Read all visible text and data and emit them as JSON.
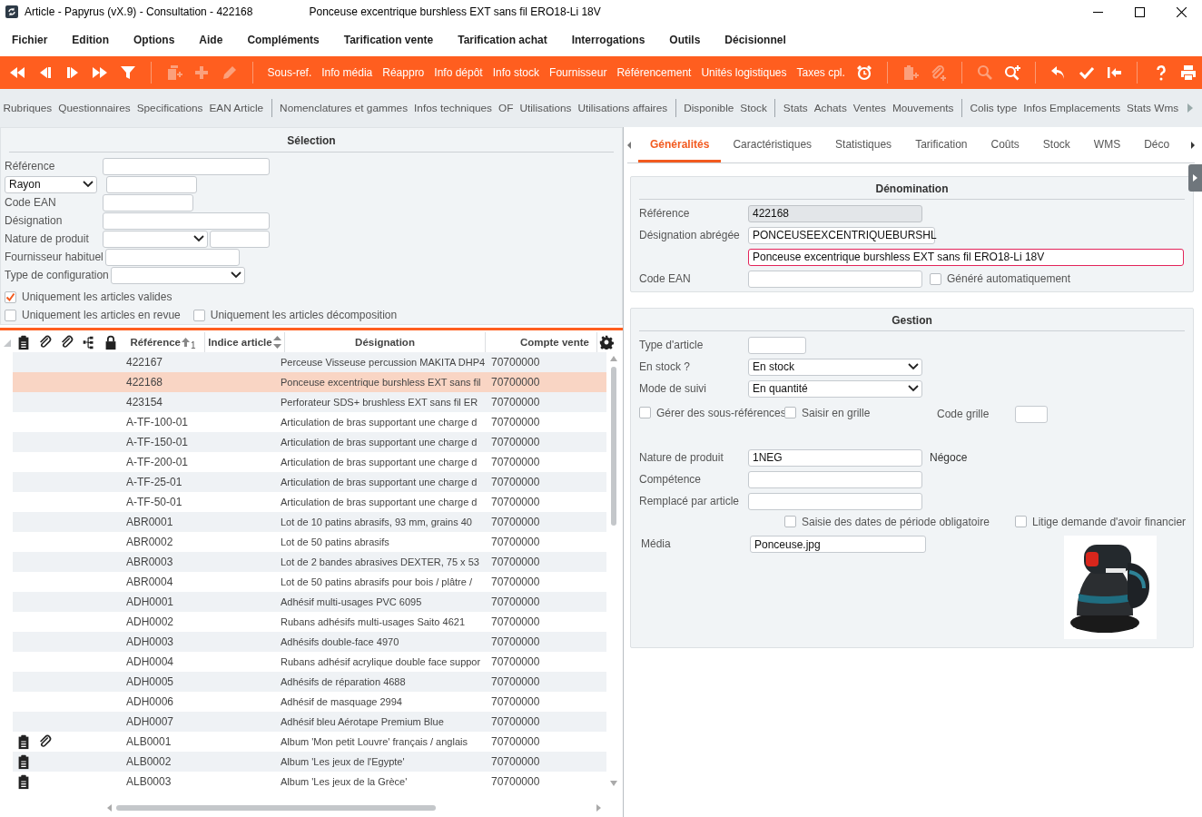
{
  "window": {
    "title": "Article - Papyrus (vX.9) - Consultation - 422168",
    "subtitle": "Ponceuse excentrique burshless EXT sans fil ERO18-Li 18V"
  },
  "menu": [
    "Fichier",
    "Edition",
    "Options",
    "Aide",
    "Compléments",
    "Tarification vente",
    "Tarification achat",
    "Interrogations",
    "Outils",
    "Décisionnel"
  ],
  "toolbar": [
    {
      "kind": "rewind",
      "disabled": false
    },
    {
      "kind": "step-back",
      "disabled": false
    },
    {
      "kind": "step-forward",
      "disabled": false
    },
    {
      "kind": "fast-forward",
      "disabled": false
    },
    {
      "kind": "filter",
      "disabled": false
    },
    {
      "kind": "separator"
    },
    {
      "kind": "copy-plus",
      "disabled": true
    },
    {
      "kind": "plus",
      "disabled": true
    },
    {
      "kind": "pencil",
      "disabled": true
    },
    {
      "kind": "separator"
    },
    {
      "kind": "text",
      "label": "Sous-ref."
    },
    {
      "kind": "text",
      "label": "Info média"
    },
    {
      "kind": "text",
      "label": "Réappro"
    },
    {
      "kind": "text",
      "label": "Info dépôt"
    },
    {
      "kind": "text",
      "label": "Info stock"
    },
    {
      "kind": "text",
      "label": "Fournisseur"
    },
    {
      "kind": "text",
      "label": "Référencement"
    },
    {
      "kind": "text",
      "label": "Unités logistiques"
    },
    {
      "kind": "text",
      "label": "Taxes cpl."
    },
    {
      "kind": "alarm-clock",
      "disabled": false
    },
    {
      "kind": "separator"
    },
    {
      "kind": "clipboard-plus",
      "disabled": true
    },
    {
      "kind": "paperclip-plus",
      "disabled": true
    },
    {
      "kind": "separator"
    },
    {
      "kind": "search",
      "disabled": true
    },
    {
      "kind": "zoom-in",
      "disabled": false
    },
    {
      "kind": "separator"
    },
    {
      "kind": "undo",
      "disabled": false
    },
    {
      "kind": "check",
      "disabled": false
    },
    {
      "kind": "back-to-start",
      "disabled": false
    },
    {
      "kind": "separator"
    },
    {
      "kind": "help",
      "disabled": false
    },
    {
      "kind": "print",
      "disabled": false
    }
  ],
  "linkbar": [
    [
      "Rubriques",
      "Questionnaires",
      "Specifications",
      "EAN Article"
    ],
    [
      "Nomenclatures et gammes",
      "Infos techniques",
      "OF",
      "Utilisations",
      "Utilisations affaires"
    ],
    [
      "Disponible",
      "Stock"
    ],
    [
      "Stats",
      "Achats",
      "Ventes",
      "Mouvements"
    ],
    [
      "Colis type",
      "Infos Emplacements",
      "Stats Wms"
    ]
  ],
  "selection": {
    "title": "Sélection",
    "fields": [
      {
        "label": "Référence",
        "controls": [
          {
            "kind": "input"
          }
        ]
      },
      {
        "label_dropdown": "Rayon",
        "controls": [
          {
            "kind": "input"
          }
        ]
      },
      {
        "label": "Code EAN",
        "controls": [
          {
            "kind": "input"
          }
        ]
      },
      {
        "label": "Désignation",
        "controls": [
          {
            "kind": "input"
          }
        ]
      },
      {
        "label": "Nature de produit",
        "controls": [
          {
            "kind": "select"
          },
          {
            "kind": "input"
          }
        ]
      },
      {
        "label": "Fournisseur habituel",
        "controls": [
          {
            "kind": "input"
          }
        ]
      },
      {
        "label": "Type de configuration",
        "controls": [
          {
            "kind": "select"
          }
        ]
      }
    ],
    "checkbox_rows": [
      [
        {
          "label": "Uniquement les articles valides",
          "checked": true
        }
      ],
      [
        {
          "label": "Uniquement les articles en revue",
          "checked": false
        },
        {
          "label": "Uniquement les articles décomposition",
          "checked": false
        }
      ]
    ]
  },
  "grid": {
    "columns": [
      {
        "label": "Référence",
        "sorted": true,
        "sortable": true,
        "sort_rank": "1"
      },
      {
        "label": "Indice article",
        "sorted": false,
        "sortable": true
      },
      {
        "label": "Désignation",
        "sorted": false,
        "sortable": false
      },
      {
        "label": "Compte vente",
        "sorted": false,
        "sortable": false
      }
    ],
    "rows": [
      {
        "reference": "422167",
        "designation": "Perceuse Visseuse percussion MAKITA DHP4",
        "account": "70700000",
        "selected": false,
        "notes": false,
        "files": false
      },
      {
        "reference": "422168",
        "designation": "Ponceuse excentrique burshless EXT sans fil",
        "account": "70700000",
        "selected": true,
        "notes": false,
        "files": false
      },
      {
        "reference": "423154",
        "designation": "Perforateur SDS+ brushless EXT sans fil ER",
        "account": "70700000",
        "selected": false,
        "notes": false,
        "files": false
      },
      {
        "reference": "A-TF-100-01",
        "designation": "Articulation de bras supportant une charge d",
        "account": "70700000",
        "selected": false,
        "notes": false,
        "files": false
      },
      {
        "reference": "A-TF-150-01",
        "designation": "Articulation de bras supportant une charge d",
        "account": "70700000",
        "selected": false,
        "notes": false,
        "files": false
      },
      {
        "reference": "A-TF-200-01",
        "designation": "Articulation de bras supportant une charge d",
        "account": "70700000",
        "selected": false,
        "notes": false,
        "files": false
      },
      {
        "reference": "A-TF-25-01",
        "designation": "Articulation de bras supportant une charge d",
        "account": "70700000",
        "selected": false,
        "notes": false,
        "files": false
      },
      {
        "reference": "A-TF-50-01",
        "designation": "Articulation de bras supportant une charge d",
        "account": "70700000",
        "selected": false,
        "notes": false,
        "files": false
      },
      {
        "reference": "ABR0001",
        "designation": "Lot de 10 patins abrasifs, 93 mm, grains 40",
        "account": "70700000",
        "selected": false,
        "notes": false,
        "files": false
      },
      {
        "reference": "ABR0002",
        "designation": "Lot de 50 patins abrasifs",
        "account": "70700000",
        "selected": false,
        "notes": false,
        "files": false
      },
      {
        "reference": "ABR0003",
        "designation": "Lot de 2 bandes abrasives DEXTER, 75 x 53",
        "account": "70700000",
        "selected": false,
        "notes": false,
        "files": false
      },
      {
        "reference": "ABR0004",
        "designation": "Lot de 50 patins abrasifs pour bois / plâtre /",
        "account": "70700000",
        "selected": false,
        "notes": false,
        "files": false
      },
      {
        "reference": "ADH0001",
        "designation": "Adhésif multi-usages PVC 6095",
        "account": "70700000",
        "selected": false,
        "notes": false,
        "files": false
      },
      {
        "reference": "ADH0002",
        "designation": "Rubans adhésifs multi-usages Saito 4621",
        "account": "70700000",
        "selected": false,
        "notes": false,
        "files": false
      },
      {
        "reference": "ADH0003",
        "designation": "Adhésifs double-face 4970",
        "account": "70700000",
        "selected": false,
        "notes": false,
        "files": false
      },
      {
        "reference": "ADH0004",
        "designation": "Rubans adhésif acrylique double face suppor",
        "account": "70700000",
        "selected": false,
        "notes": false,
        "files": false
      },
      {
        "reference": "ADH0005",
        "designation": "Adhésifs de réparation 4688",
        "account": "70700000",
        "selected": false,
        "notes": false,
        "files": false
      },
      {
        "reference": "ADH0006",
        "designation": "Adhésif de masquage 2994",
        "account": "70700000",
        "selected": false,
        "notes": false,
        "files": false
      },
      {
        "reference": "ADH0007",
        "designation": "Adhésif bleu Aérotape Premium Blue",
        "account": "70700000",
        "selected": false,
        "notes": false,
        "files": false
      },
      {
        "reference": "ALB0001",
        "designation": "Album 'Mon petit Louvre'  français / anglais",
        "account": "70700000",
        "selected": false,
        "notes": true,
        "files": true
      },
      {
        "reference": "ALB0002",
        "designation": "Album 'Les jeux de l'Egypte'",
        "account": "70700000",
        "selected": false,
        "notes": true,
        "files": false
      },
      {
        "reference": "ALB0003",
        "designation": "Album 'Les jeux de la Grèce'",
        "account": "70700000",
        "selected": false,
        "notes": true,
        "files": false
      }
    ]
  },
  "detail": {
    "tabs": [
      {
        "label": "Généralités",
        "selected": true
      },
      {
        "label": "Caractéristiques",
        "selected": false
      },
      {
        "label": "Statistiques",
        "selected": false
      },
      {
        "label": "Tarification",
        "selected": false
      },
      {
        "label": "Coûts",
        "selected": false
      },
      {
        "label": "Stock",
        "selected": false
      },
      {
        "label": "WMS",
        "selected": false
      },
      {
        "label": "Déco",
        "selected": false
      }
    ],
    "denomination": {
      "title": "Dénomination",
      "fields": [
        {
          "label": "Référence",
          "control": {
            "kind": "input",
            "value": "422168",
            "readonly": true
          }
        },
        {
          "label": "Désignation abrégée",
          "control": {
            "kind": "input",
            "value": "PONCEUSEEXCENTRIQUEBURSHL"
          }
        },
        {
          "control": {
            "kind": "input",
            "value": "Ponceuse excentrique burshless EXT sans fil ERO18-Li 18V",
            "invalid": true
          }
        },
        {
          "label": "Code EAN",
          "control": {
            "kind": "input"
          },
          "checkbox": {
            "label": "Généré automatiquement",
            "checked": false
          }
        }
      ]
    },
    "gestion": {
      "title": "Gestion",
      "rows": [
        {
          "kind": "field",
          "label": "Type d'article",
          "control": {
            "kind": "input"
          }
        },
        {
          "kind": "field",
          "label": "En stock ?",
          "control": {
            "kind": "select",
            "value": "En stock"
          }
        },
        {
          "kind": "field",
          "label": "Mode de suivi",
          "control": {
            "kind": "select",
            "value": "En quantité"
          }
        },
        {
          "kind": "options",
          "checkboxes": [
            {
              "label": "Gérer des sous-références",
              "checked": false
            },
            {
              "label": "Saisir en grille",
              "checked": false
            }
          ],
          "label": "Code grille",
          "control": {
            "kind": "input"
          }
        },
        {
          "kind": "field",
          "label": "Nature de produit",
          "control": {
            "kind": "input",
            "value": "1NEG"
          },
          "note": "Négoce"
        },
        {
          "kind": "field",
          "label": "Compétence",
          "control": {
            "kind": "input"
          }
        },
        {
          "kind": "field",
          "label": "Remplacé par article",
          "control": {
            "kind": "input"
          }
        },
        {
          "kind": "options",
          "checkboxes": [
            {
              "label": "Saisie des dates de période obligatoire",
              "checked": false
            },
            {
              "label": "Litige demande d'avoir financier",
              "checked": false
            }
          ]
        },
        {
          "kind": "media",
          "label": "Média",
          "control": {
            "kind": "input",
            "value": "Ponceuse.jpg"
          }
        }
      ]
    }
  }
}
